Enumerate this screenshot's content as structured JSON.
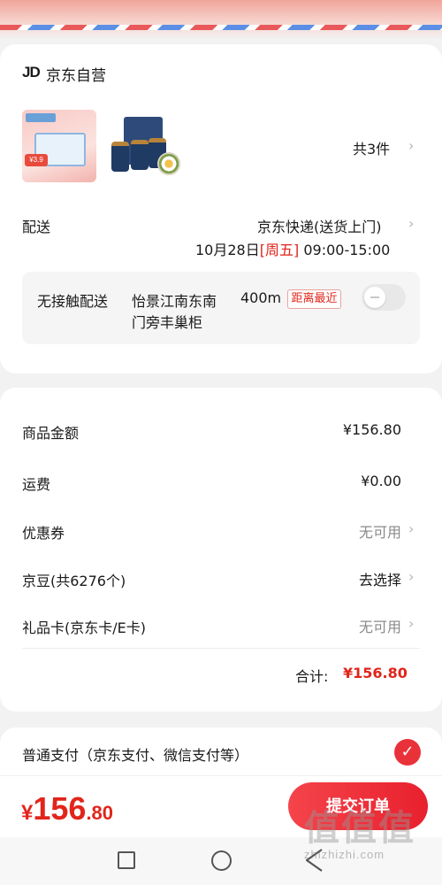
{
  "header": {
    "shop_logo": "JD",
    "shop_name": "京东自营"
  },
  "products": {
    "count_text": "共3件",
    "thumb1_price_tag": "¥3.9"
  },
  "delivery": {
    "label": "配送",
    "method": "京东快递(送货上门)",
    "date": "10月28日",
    "weekday": "[周五]",
    "time_range": "09:00-15:00"
  },
  "contactless": {
    "label": "无接触配送",
    "locker_line1": "怡景江南东南",
    "locker_line2": "门旁丰巢柜",
    "distance": "400m",
    "badge": "距离最近",
    "enabled": false
  },
  "summary": {
    "rows": [
      {
        "label": "商品金额",
        "value": "¥156.80"
      },
      {
        "label": "运费",
        "value": "¥0.00"
      },
      {
        "label": "优惠券",
        "value": "无可用"
      },
      {
        "label": "京豆(共6276个)",
        "value": "去选择"
      },
      {
        "label": "礼品卡(京东卡/E卡)",
        "value": "无可用"
      }
    ],
    "total_label": "合计:",
    "total_value": "¥156.80"
  },
  "payment": {
    "method_label": "普通支付（京东支付、微信支付等）",
    "selected": true
  },
  "footer": {
    "currency": "¥",
    "amount_int": "156",
    "amount_dec": ".80",
    "submit_label": "提交订单"
  },
  "watermark": {
    "big": "值值值",
    "domain": "zhizhizhi.com"
  },
  "colors": {
    "accent": "#e1251b",
    "button": "#e8202d"
  },
  "icons": [
    "chevron-right-icon",
    "checkmark-icon",
    "nav-recent-icon",
    "nav-home-icon",
    "nav-back-icon"
  ]
}
